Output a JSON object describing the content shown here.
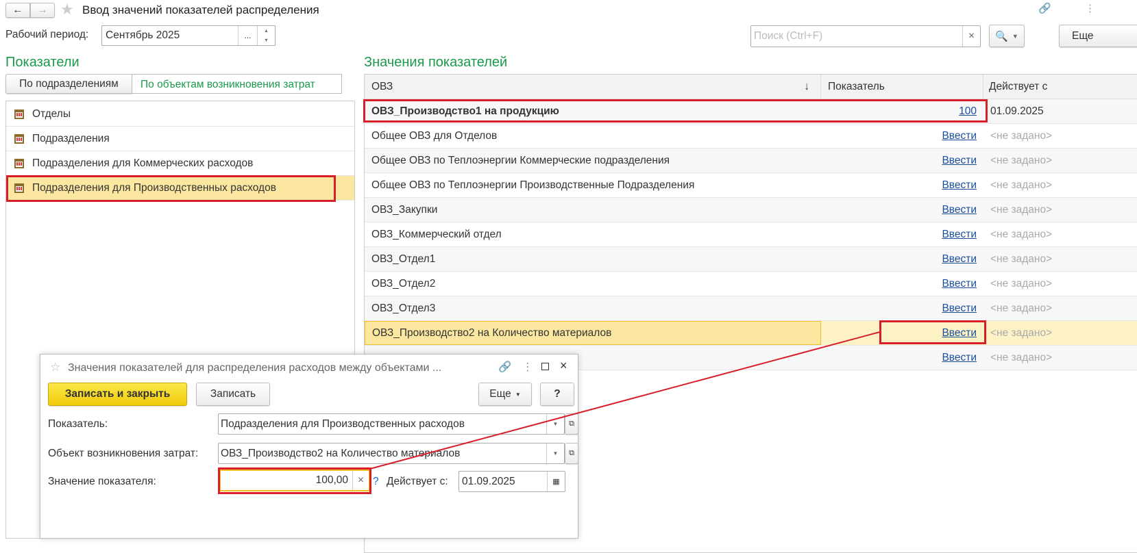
{
  "window": {
    "title": "Ввод значений показателей распределения",
    "back": "←",
    "forward": "→"
  },
  "period": {
    "label": "Рабочий период:",
    "value": "Сентябрь 2025",
    "select": "..."
  },
  "search": {
    "placeholder": "Поиск (Ctrl+F)",
    "clear": "×",
    "more": "Еще"
  },
  "left": {
    "title": "Показатели",
    "tabs": [
      "По подразделениям",
      "По объектам возникновения затрат"
    ],
    "items": [
      "Отделы",
      "Подразделения",
      "Подразделения для Коммерческих расходов",
      "Подразделения для Производственных расходов"
    ]
  },
  "right": {
    "title": "Значения показателей",
    "columns": [
      "ОВЗ",
      "Показатель",
      "Действует с"
    ],
    "sort_arrow": "↓",
    "rows": [
      {
        "name": "ОВЗ_Производство1 на продукцию",
        "value": "100",
        "date": "01.09.2025"
      },
      {
        "name": "Общее ОВЗ для Отделов",
        "value": "Ввести",
        "date": "<не задано>"
      },
      {
        "name": "Общее ОВЗ по Теплоэнергии Коммерческие подразделения",
        "value": "Ввести",
        "date": "<не задано>"
      },
      {
        "name": "Общее ОВЗ по Теплоэнергии Производственные Подразделения",
        "value": "Ввести",
        "date": "<не задано>"
      },
      {
        "name": "ОВЗ_Закупки",
        "value": "Ввести",
        "date": "<не задано>"
      },
      {
        "name": "ОВЗ_Коммерческий отдел",
        "value": "Ввести",
        "date": "<не задано>"
      },
      {
        "name": "ОВЗ_Отдел1",
        "value": "Ввести",
        "date": "<не задано>"
      },
      {
        "name": "ОВЗ_Отдел2",
        "value": "Ввести",
        "date": "<не задано>"
      },
      {
        "name": "ОВЗ_Отдел3",
        "value": "Ввести",
        "date": "<не задано>"
      },
      {
        "name": "ОВЗ_Производство2 на Количество материалов",
        "value": "Ввести",
        "date": "<не задано>"
      },
      {
        "name": "",
        "value": "Ввести",
        "date": "<не задано>"
      }
    ]
  },
  "dialog": {
    "title": "Значения показателей для распределения расходов между объектами ...",
    "save_close": "Записать и закрыть",
    "save": "Записать",
    "more": "Еще",
    "help": "?",
    "indicator_label": "Показатель:",
    "indicator_value": "Подразделения для Производственных расходов",
    "object_label": "Объект возникновения затрат:",
    "object_value": "ОВЗ_Производство2 на Количество материалов",
    "value_label": "Значение показателя:",
    "value": "100,00",
    "clear": "×",
    "q": "?",
    "date_label": "Действует с:",
    "date_value": "01.09.2025"
  }
}
